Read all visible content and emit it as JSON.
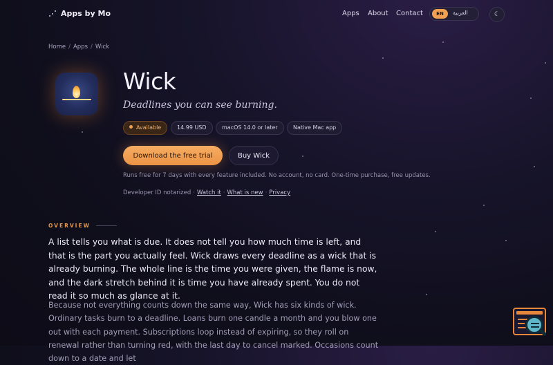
{
  "nav": {
    "brand": "Apps by Mo",
    "links": [
      "Apps",
      "About",
      "Contact"
    ],
    "lang_active": "EN",
    "lang_other": "العربية",
    "theme_icon": "moon-icon"
  },
  "breadcrumb": [
    "Home",
    "Apps",
    "Wick"
  ],
  "hero": {
    "title": "Wick",
    "tagline": "Deadlines you can see burning.",
    "chips": [
      "Available",
      "14.99 USD",
      "macOS 14.0 or later",
      "Native Mac app"
    ],
    "primary_button": "Download the free trial",
    "secondary_button": "Buy Wick",
    "note": "Runs free for 7 days with every feature included. No account, no card. One-time purchase, free updates.",
    "links_prefix": "Developer ID notarized",
    "links": [
      "Watch it",
      "What is new",
      "Privacy"
    ]
  },
  "overview": {
    "eyebrow": "OVERVIEW",
    "lead": "A list tells you what is due. It does not tell you how much time is left, and that is the part you actually feel. Wick draws every deadline as a wick that is already burning. The whole line is the time you were given, the flame is now, and the dark stretch behind it is time you have already spent. You do not read it so much as glance at it.",
    "body": "Because not everything counts down the same way, Wick has six kinds of wick. Ordinary tasks burn to a deadline. Loans burn one candle a month and you blow one out with each payment. Subscriptions loop instead of expiring, so they roll on renewal rather than turning red, with the last day to cancel marked. Occasions count down to a date and let"
  },
  "colors": {
    "accent": "#f0a050",
    "background": "#13111f"
  }
}
